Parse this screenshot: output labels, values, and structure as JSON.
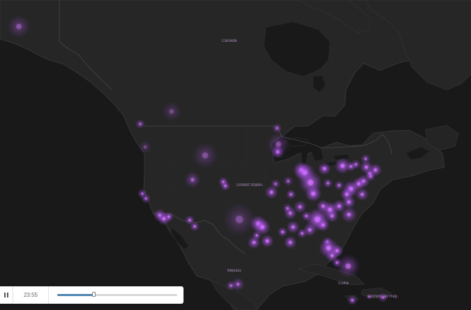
{
  "map": {
    "labels": {
      "canada": "Canada",
      "united_states": "United States",
      "mexico": "Mexico",
      "cuba": "Cuba",
      "dominican_republic": "Dominican Rep."
    },
    "colors": {
      "water": "#191919",
      "land": "#242424",
      "border": "#3a3a3a",
      "point": "#cc66ff",
      "glow": "#8c3ed2"
    }
  },
  "player": {
    "pause_icon": "pause-icon",
    "time": "23:55",
    "progress": 0.3
  }
}
